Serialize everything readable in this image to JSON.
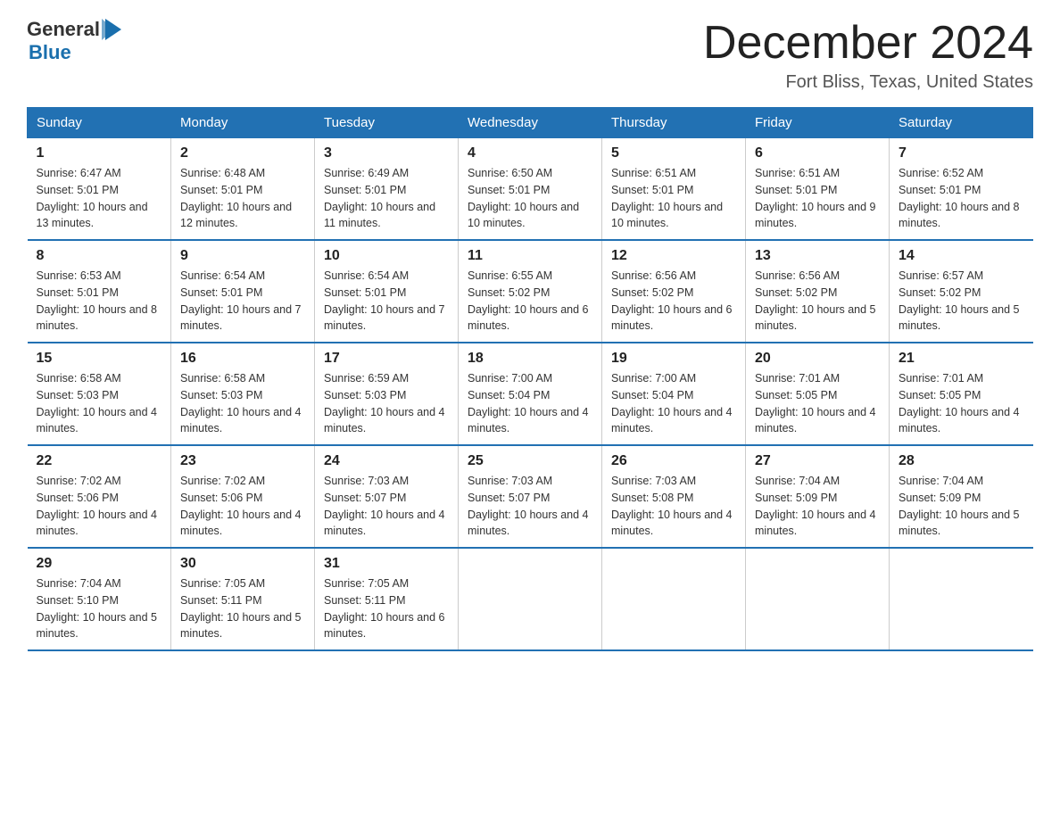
{
  "header": {
    "logo_general": "General",
    "logo_blue": "Blue",
    "title": "December 2024",
    "subtitle": "Fort Bliss, Texas, United States"
  },
  "calendar": {
    "weekdays": [
      "Sunday",
      "Monday",
      "Tuesday",
      "Wednesday",
      "Thursday",
      "Friday",
      "Saturday"
    ],
    "weeks": [
      [
        {
          "day": "1",
          "sunrise": "6:47 AM",
          "sunset": "5:01 PM",
          "daylight": "10 hours and 13 minutes."
        },
        {
          "day": "2",
          "sunrise": "6:48 AM",
          "sunset": "5:01 PM",
          "daylight": "10 hours and 12 minutes."
        },
        {
          "day": "3",
          "sunrise": "6:49 AM",
          "sunset": "5:01 PM",
          "daylight": "10 hours and 11 minutes."
        },
        {
          "day": "4",
          "sunrise": "6:50 AM",
          "sunset": "5:01 PM",
          "daylight": "10 hours and 10 minutes."
        },
        {
          "day": "5",
          "sunrise": "6:51 AM",
          "sunset": "5:01 PM",
          "daylight": "10 hours and 10 minutes."
        },
        {
          "day": "6",
          "sunrise": "6:51 AM",
          "sunset": "5:01 PM",
          "daylight": "10 hours and 9 minutes."
        },
        {
          "day": "7",
          "sunrise": "6:52 AM",
          "sunset": "5:01 PM",
          "daylight": "10 hours and 8 minutes."
        }
      ],
      [
        {
          "day": "8",
          "sunrise": "6:53 AM",
          "sunset": "5:01 PM",
          "daylight": "10 hours and 8 minutes."
        },
        {
          "day": "9",
          "sunrise": "6:54 AM",
          "sunset": "5:01 PM",
          "daylight": "10 hours and 7 minutes."
        },
        {
          "day": "10",
          "sunrise": "6:54 AM",
          "sunset": "5:01 PM",
          "daylight": "10 hours and 7 minutes."
        },
        {
          "day": "11",
          "sunrise": "6:55 AM",
          "sunset": "5:02 PM",
          "daylight": "10 hours and 6 minutes."
        },
        {
          "day": "12",
          "sunrise": "6:56 AM",
          "sunset": "5:02 PM",
          "daylight": "10 hours and 6 minutes."
        },
        {
          "day": "13",
          "sunrise": "6:56 AM",
          "sunset": "5:02 PM",
          "daylight": "10 hours and 5 minutes."
        },
        {
          "day": "14",
          "sunrise": "6:57 AM",
          "sunset": "5:02 PM",
          "daylight": "10 hours and 5 minutes."
        }
      ],
      [
        {
          "day": "15",
          "sunrise": "6:58 AM",
          "sunset": "5:03 PM",
          "daylight": "10 hours and 4 minutes."
        },
        {
          "day": "16",
          "sunrise": "6:58 AM",
          "sunset": "5:03 PM",
          "daylight": "10 hours and 4 minutes."
        },
        {
          "day": "17",
          "sunrise": "6:59 AM",
          "sunset": "5:03 PM",
          "daylight": "10 hours and 4 minutes."
        },
        {
          "day": "18",
          "sunrise": "7:00 AM",
          "sunset": "5:04 PM",
          "daylight": "10 hours and 4 minutes."
        },
        {
          "day": "19",
          "sunrise": "7:00 AM",
          "sunset": "5:04 PM",
          "daylight": "10 hours and 4 minutes."
        },
        {
          "day": "20",
          "sunrise": "7:01 AM",
          "sunset": "5:05 PM",
          "daylight": "10 hours and 4 minutes."
        },
        {
          "day": "21",
          "sunrise": "7:01 AM",
          "sunset": "5:05 PM",
          "daylight": "10 hours and 4 minutes."
        }
      ],
      [
        {
          "day": "22",
          "sunrise": "7:02 AM",
          "sunset": "5:06 PM",
          "daylight": "10 hours and 4 minutes."
        },
        {
          "day": "23",
          "sunrise": "7:02 AM",
          "sunset": "5:06 PM",
          "daylight": "10 hours and 4 minutes."
        },
        {
          "day": "24",
          "sunrise": "7:03 AM",
          "sunset": "5:07 PM",
          "daylight": "10 hours and 4 minutes."
        },
        {
          "day": "25",
          "sunrise": "7:03 AM",
          "sunset": "5:07 PM",
          "daylight": "10 hours and 4 minutes."
        },
        {
          "day": "26",
          "sunrise": "7:03 AM",
          "sunset": "5:08 PM",
          "daylight": "10 hours and 4 minutes."
        },
        {
          "day": "27",
          "sunrise": "7:04 AM",
          "sunset": "5:09 PM",
          "daylight": "10 hours and 4 minutes."
        },
        {
          "day": "28",
          "sunrise": "7:04 AM",
          "sunset": "5:09 PM",
          "daylight": "10 hours and 5 minutes."
        }
      ],
      [
        {
          "day": "29",
          "sunrise": "7:04 AM",
          "sunset": "5:10 PM",
          "daylight": "10 hours and 5 minutes."
        },
        {
          "day": "30",
          "sunrise": "7:05 AM",
          "sunset": "5:11 PM",
          "daylight": "10 hours and 5 minutes."
        },
        {
          "day": "31",
          "sunrise": "7:05 AM",
          "sunset": "5:11 PM",
          "daylight": "10 hours and 6 minutes."
        },
        null,
        null,
        null,
        null
      ]
    ]
  }
}
